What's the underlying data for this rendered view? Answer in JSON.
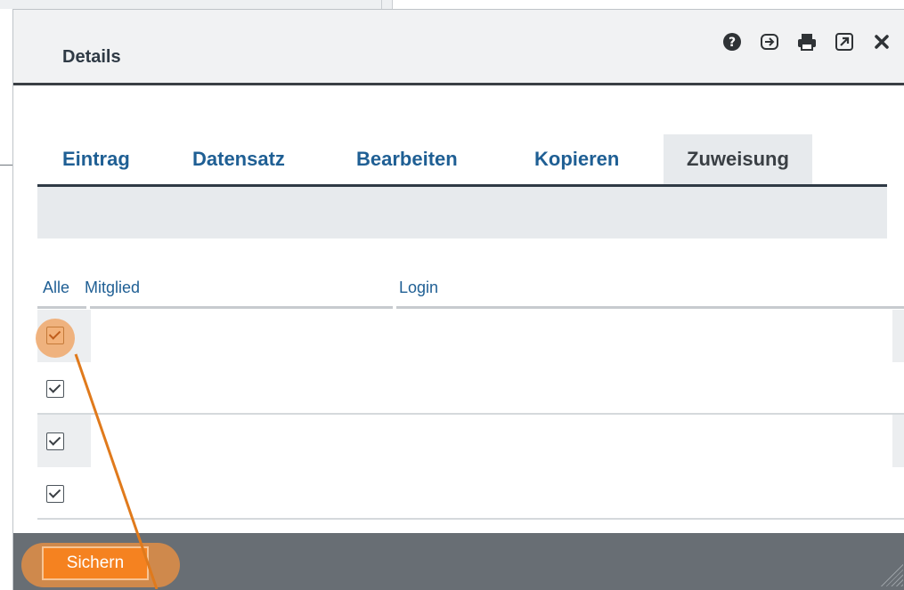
{
  "dialog": {
    "title": "Details",
    "header_icons": [
      "help-icon",
      "login-icon",
      "print-icon",
      "open-external-icon",
      "close-icon"
    ]
  },
  "tabs": [
    {
      "label": "Eintrag",
      "active": false
    },
    {
      "label": "Datensatz",
      "active": false
    },
    {
      "label": "Bearbeiten",
      "active": false
    },
    {
      "label": "Kopieren",
      "active": false
    },
    {
      "label": "Zuweisung",
      "active": true
    }
  ],
  "table": {
    "columns": {
      "all": "Alle",
      "member": "Mitglied",
      "login": "Login"
    },
    "rows": [
      {
        "checked": true
      },
      {
        "checked": true
      },
      {
        "checked": true
      },
      {
        "checked": true
      }
    ]
  },
  "footer": {
    "save_label": "Sichern"
  },
  "colors": {
    "accent": "#f58220",
    "link": "#1f5f94",
    "footer_bg": "#686e74",
    "highlight": "#f0a76a"
  }
}
